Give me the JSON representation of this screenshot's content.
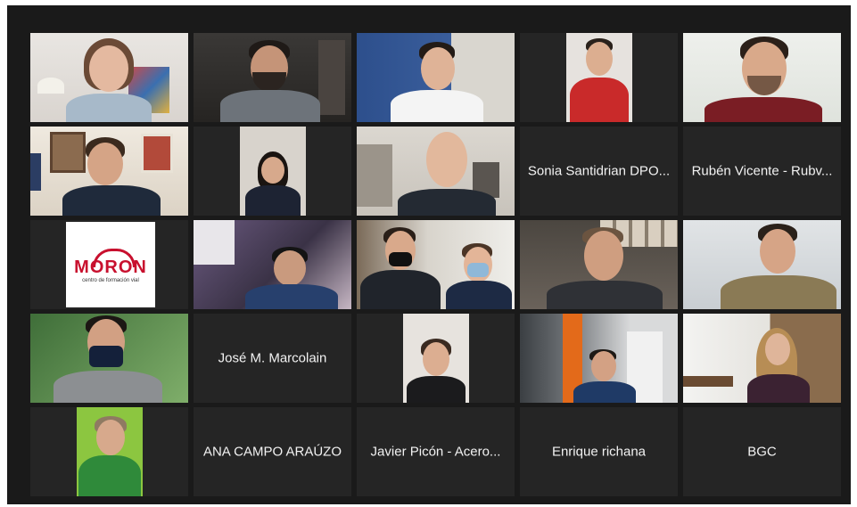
{
  "meeting": {
    "active_speaker_color": "#a8d24a",
    "tiles": [
      {
        "id": "t1",
        "type": "video"
      },
      {
        "id": "t2",
        "type": "video"
      },
      {
        "id": "t3",
        "type": "video"
      },
      {
        "id": "t4",
        "type": "video"
      },
      {
        "id": "t5",
        "type": "video",
        "active_speaker": true
      },
      {
        "id": "t6",
        "type": "video"
      },
      {
        "id": "t7",
        "type": "video"
      },
      {
        "id": "t8",
        "type": "video"
      },
      {
        "id": "t9",
        "type": "name",
        "name": "Sonia Santidrian DPO..."
      },
      {
        "id": "t10",
        "type": "name",
        "name": "Rubén Vicente - Rubv..."
      },
      {
        "id": "t11",
        "type": "logo",
        "logo": {
          "word": "MORON",
          "tagline": "centro de formación vial"
        }
      },
      {
        "id": "t12",
        "type": "video"
      },
      {
        "id": "t13",
        "type": "video"
      },
      {
        "id": "t14",
        "type": "video"
      },
      {
        "id": "t15",
        "type": "video"
      },
      {
        "id": "t16",
        "type": "video"
      },
      {
        "id": "t17",
        "type": "name",
        "name": "José M. Marcolain"
      },
      {
        "id": "t18",
        "type": "video"
      },
      {
        "id": "t19",
        "type": "video"
      },
      {
        "id": "t20",
        "type": "video"
      },
      {
        "id": "t21",
        "type": "video"
      },
      {
        "id": "t22",
        "type": "name",
        "name": "ANA CAMPO ARAÚZO"
      },
      {
        "id": "t23",
        "type": "name",
        "name": "Javier Picón - Acero..."
      },
      {
        "id": "t24",
        "type": "name",
        "name": "Enrique richana"
      },
      {
        "id": "t25",
        "type": "name",
        "name": "BGC"
      }
    ]
  }
}
